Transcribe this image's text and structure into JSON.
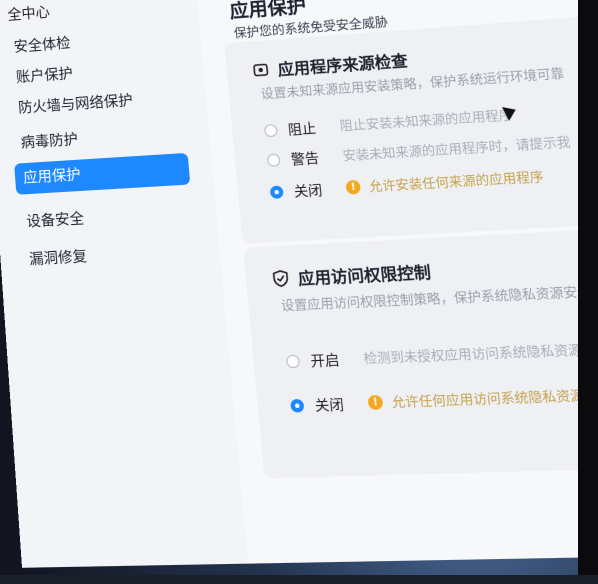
{
  "sidebar": {
    "title": "全中心",
    "items": [
      {
        "label": "安全体检",
        "active": false
      },
      {
        "label": "账户保护",
        "active": false
      },
      {
        "label": "防火墙与网络保护",
        "active": false
      },
      {
        "label": "病毒防护",
        "active": false
      },
      {
        "label": "应用保护",
        "active": true
      },
      {
        "label": "设备安全",
        "active": false
      },
      {
        "label": "漏洞修复",
        "active": false
      }
    ]
  },
  "main": {
    "title": "应用保护",
    "subtitle": "保护您的系统免受安全威胁",
    "source_check": {
      "title": "应用程序来源检查",
      "description": "设置未知来源应用安装策略，保护系统运行环境可靠",
      "options": [
        {
          "label": "阻止",
          "note": "阻止安装未知来源的应用程序",
          "selected": false
        },
        {
          "label": "警告",
          "note": "安装未知来源的应用程序时，请提示我",
          "selected": false
        },
        {
          "label": "关闭",
          "note": "允许安装任何来源的应用程序",
          "selected": true,
          "warning": true
        }
      ]
    },
    "access_control": {
      "title": "应用访问权限控制",
      "description": "设置应用访问权限控制策略，保护系统隐私资源安全",
      "options": [
        {
          "label": "开启",
          "note": "检测到未授权应用访问系统隐私资源时，请",
          "selected": false
        },
        {
          "label": "关闭",
          "note": "允许任何应用访问系统隐私资源",
          "selected": true,
          "warning": true
        }
      ]
    }
  },
  "colors": {
    "accent": "#1e88ff",
    "warning": "#f3a81d"
  }
}
